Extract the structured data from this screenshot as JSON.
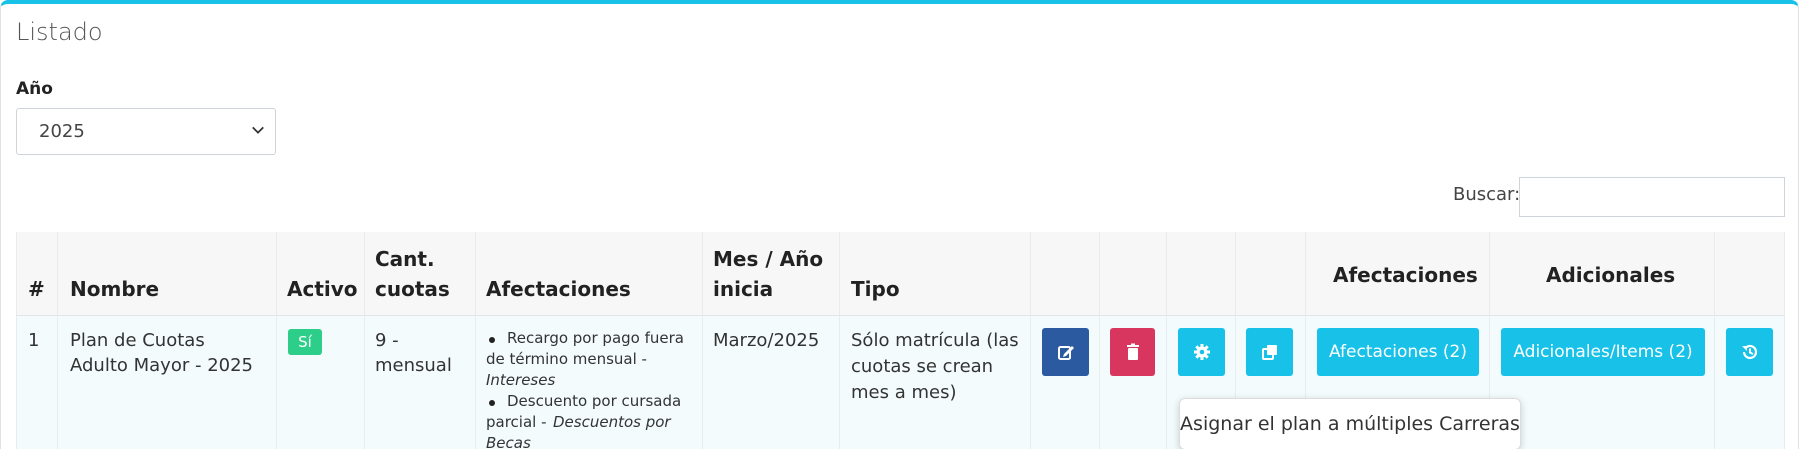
{
  "card": {
    "title": "Listado",
    "accent": "#17c1e8"
  },
  "filter": {
    "year_label": "Año",
    "year_value": "2025"
  },
  "search": {
    "label": "Buscar:",
    "value": ""
  },
  "table": {
    "headers": {
      "num": "#",
      "nombre": "Nombre",
      "activo": "Activo",
      "cant_line1": "Cant.",
      "cant_line2": "cuotas",
      "afectaciones": "Afectaciones",
      "mes_line1": "Mes / Año",
      "mes_line2": "inicia",
      "tipo": "Tipo",
      "afectaciones_btn": "Afectaciones",
      "adicionales_btn": "Adicionales"
    },
    "row": {
      "num": "1",
      "nombre_line1": "Plan de Cuotas",
      "nombre_line2": "Adulto Mayor - 2025",
      "activo": "Sí",
      "cant_line1": "9 -",
      "cant_line2": "mensual",
      "afectaciones": [
        {
          "line1": "Recargo por pago fuera",
          "line2": "de término mensual -",
          "category": "Intereses"
        },
        {
          "line1": "Descuento por cursada",
          "line2": "parcial -",
          "category_part1": "Descuentos por",
          "category_part2": "Becas"
        }
      ],
      "mes": "Marzo/2025",
      "tipo_line1": "Sólo matrícula (las",
      "tipo_line2": "cuotas se crean",
      "tipo_line3": "mes a mes)",
      "btn_afectaciones": "Afectaciones (2)",
      "btn_adicionales": "Adicionales/Items (2)"
    }
  },
  "icons": {
    "edit": "edit-icon",
    "delete": "trash-icon",
    "config": "gear-icon",
    "copy": "copy-icon",
    "history": "history-icon"
  },
  "tooltip": {
    "text": "Asignar el plan a múltiples Carreras"
  },
  "colors": {
    "edit": "#2c5aa0",
    "delete": "#d9365f",
    "info": "#17c1e8",
    "success": "#2dce89"
  }
}
